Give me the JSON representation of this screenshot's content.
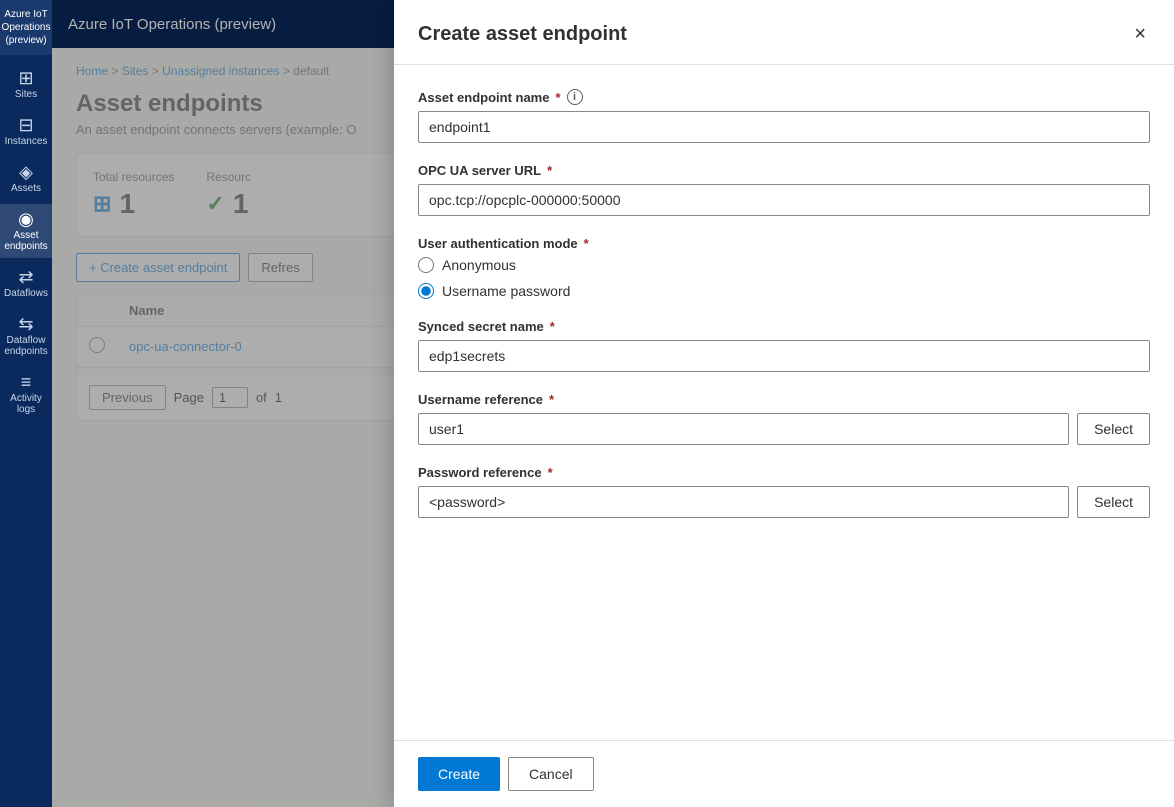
{
  "app": {
    "title": "Azure IoT Operations (preview)"
  },
  "sidebar": {
    "items": [
      {
        "id": "sites",
        "label": "Sites",
        "icon": "⊞",
        "active": false
      },
      {
        "id": "instances",
        "label": "Instances",
        "icon": "⊟",
        "active": false
      },
      {
        "id": "assets",
        "label": "Assets",
        "icon": "◈",
        "active": false
      },
      {
        "id": "asset-endpoints",
        "label": "Asset endpoints",
        "icon": "◉",
        "active": true
      },
      {
        "id": "dataflows",
        "label": "Dataflows",
        "icon": "⇄",
        "active": false
      },
      {
        "id": "dataflow-endpoints",
        "label": "Dataflow endpoints",
        "icon": "⇆",
        "active": false
      },
      {
        "id": "activity-logs",
        "label": "Activity logs",
        "icon": "≡",
        "active": false
      }
    ]
  },
  "breadcrumb": {
    "items": [
      "Home",
      "Sites",
      "Unassigned instances",
      "default"
    ]
  },
  "page": {
    "title": "Asset endpoints",
    "subtitle": "An asset endpoint connects servers (example: O"
  },
  "stats": {
    "total_label": "Total resources",
    "total_value": "1",
    "total_icon": "⊞",
    "resource_label": "Resourc",
    "resource_value": "1",
    "resource_icon": "✓"
  },
  "toolbar": {
    "create_label": "+ Create asset endpoint",
    "refresh_label": "Refres"
  },
  "table": {
    "columns": [
      "Name"
    ],
    "rows": [
      {
        "name": "opc-ua-connector-0"
      }
    ]
  },
  "pagination": {
    "previous_label": "Previous",
    "page_label": "Page",
    "page_value": "1",
    "of_label": "of",
    "total_pages": "1"
  },
  "dialog": {
    "title": "Create asset endpoint",
    "close_label": "×",
    "fields": {
      "endpoint_name": {
        "label": "Asset endpoint name",
        "required": true,
        "has_info": true,
        "value": "endpoint1",
        "placeholder": "endpoint1"
      },
      "server_url": {
        "label": "OPC UA server URL",
        "required": true,
        "value": "opc.tcp://opcplc-000000:50000",
        "placeholder": "opc.tcp://opcplc-000000:50000"
      },
      "auth_mode": {
        "label": "User authentication mode",
        "required": true,
        "options": [
          {
            "id": "anonymous",
            "label": "Anonymous",
            "selected": false
          },
          {
            "id": "username-password",
            "label": "Username password",
            "selected": true
          }
        ]
      },
      "synced_secret": {
        "label": "Synced secret name",
        "required": true,
        "value": "edp1secrets",
        "placeholder": "edp1secrets"
      },
      "username_ref": {
        "label": "Username reference",
        "required": true,
        "value": "user1",
        "placeholder": "user1",
        "select_label": "Select"
      },
      "password_ref": {
        "label": "Password reference",
        "required": true,
        "value": "<password>",
        "placeholder": "<password>",
        "select_label": "Select"
      }
    },
    "footer": {
      "create_label": "Create",
      "cancel_label": "Cancel"
    }
  }
}
